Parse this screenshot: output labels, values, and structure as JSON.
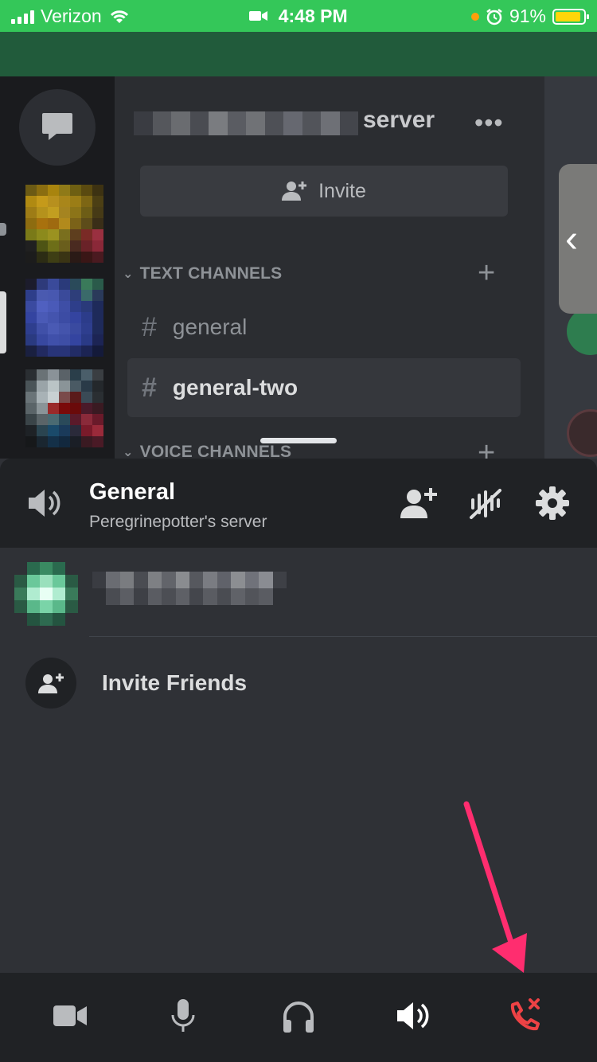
{
  "status_bar": {
    "carrier": "Verizon",
    "time": "4:48 PM",
    "battery": "91%"
  },
  "server": {
    "name_suffix": "server",
    "invite_label": "Invite"
  },
  "categories": {
    "text": "TEXT CHANNELS",
    "voice": "VOICE CHANNELS"
  },
  "channels": [
    {
      "hash": "#",
      "name": "general"
    },
    {
      "hash": "#",
      "name": "general-two"
    }
  ],
  "voice_panel": {
    "channel_name": "General",
    "server_name": "Peregrinepotter's server",
    "invite_friends": "Invite Friends"
  },
  "colors": {
    "status_bar": "#34c759",
    "disconnect": "#ed4245",
    "annotation_arrow": "#ff2d6f"
  },
  "icons": {
    "controls": [
      "video-camera-icon",
      "microphone-icon",
      "headphones-icon",
      "speaker-icon",
      "disconnect-call-icon"
    ],
    "header": [
      "add-user-icon",
      "noise-suppression-icon",
      "settings-gear-icon"
    ]
  }
}
